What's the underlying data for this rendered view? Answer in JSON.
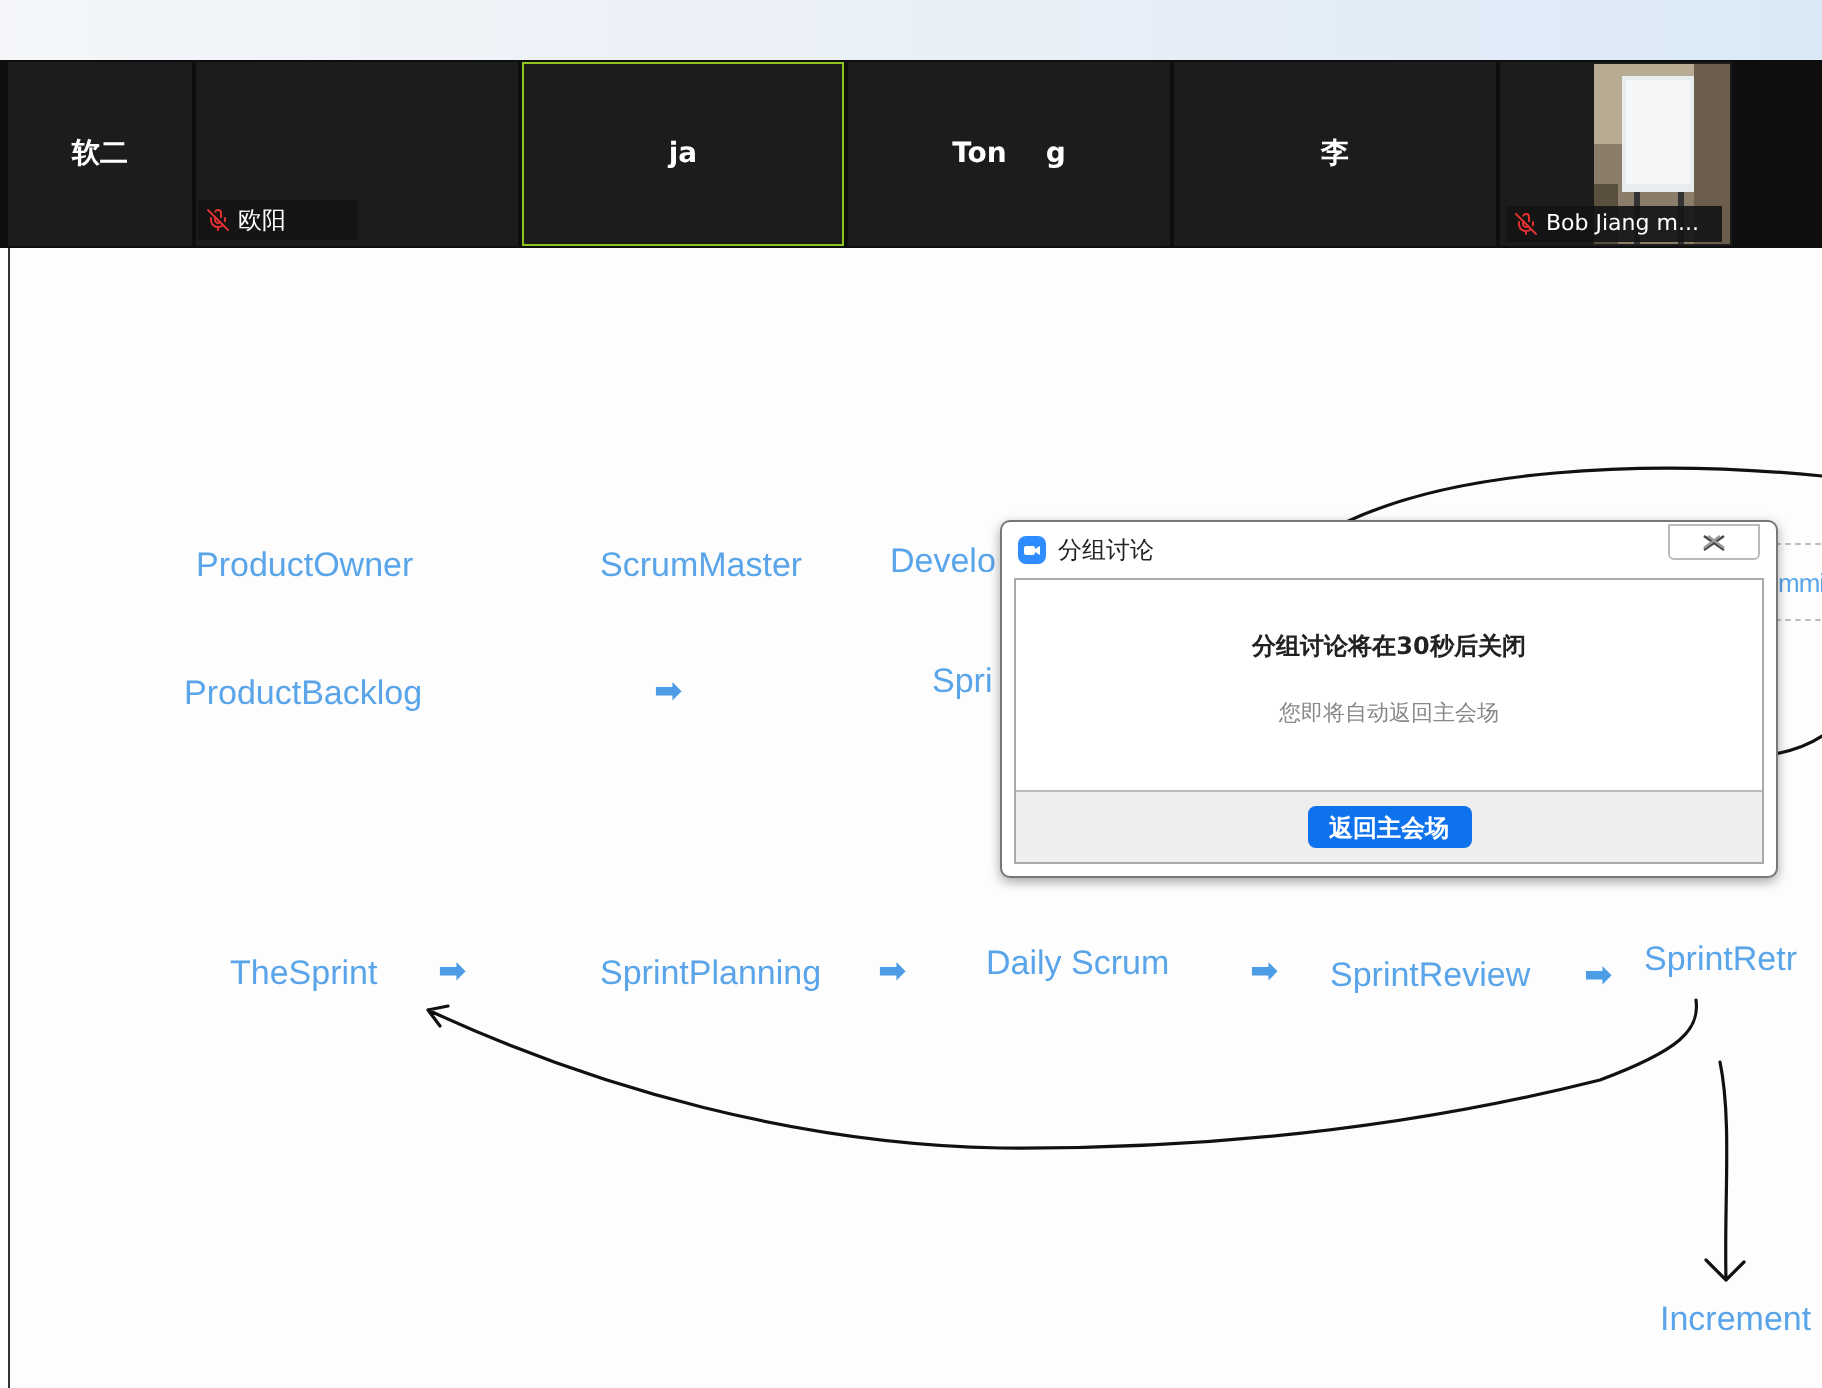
{
  "participants": [
    {
      "name": "软二",
      "kind": "name",
      "muted": false,
      "selected": false
    },
    {
      "name": "欧阳",
      "kind": "label",
      "muted": true,
      "selected": false
    },
    {
      "name": "ja",
      "kind": "name",
      "muted": false,
      "selected": true
    },
    {
      "name": "Ton    g",
      "kind": "name",
      "muted": false,
      "selected": false
    },
    {
      "name": "李",
      "kind": "name",
      "muted": false,
      "selected": false
    },
    {
      "name": "Bob Jiang m...",
      "kind": "video",
      "muted": true,
      "selected": false
    }
  ],
  "whiteboard": {
    "labels": [
      {
        "text": "ProductOwner",
        "kind": "term"
      },
      {
        "text": "ScrumMaster",
        "kind": "term"
      },
      {
        "text": "Develo",
        "kind": "term"
      },
      {
        "text": "mmi",
        "kind": "term"
      },
      {
        "text": "ProductBacklog",
        "kind": "term"
      },
      {
        "text": "➡",
        "kind": "arrow"
      },
      {
        "text": "Spri",
        "kind": "term"
      },
      {
        "text": "TheSprint",
        "kind": "term"
      },
      {
        "text": "➡",
        "kind": "arrow"
      },
      {
        "text": "SprintPlanning",
        "kind": "term"
      },
      {
        "text": "➡",
        "kind": "arrow"
      },
      {
        "text": "Daily Scrum",
        "kind": "term"
      },
      {
        "text": "➡",
        "kind": "arrow"
      },
      {
        "text": "SprintReview",
        "kind": "term"
      },
      {
        "text": "➡",
        "kind": "arrow"
      },
      {
        "text": "SprintRetr",
        "kind": "term"
      },
      {
        "text": "Increment",
        "kind": "term"
      }
    ]
  },
  "dialog": {
    "title": "分组讨论",
    "message": "分组讨论将在30秒后关闭",
    "detail": "您即将自动返回主会场",
    "button": "返回主会场"
  }
}
